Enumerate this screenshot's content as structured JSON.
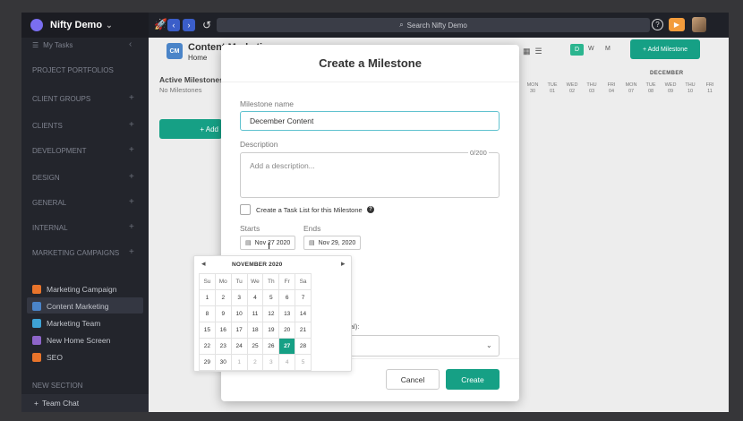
{
  "app": {
    "workspace_name": "Nifty Demo",
    "search_placeholder": "Search Nifty Demo"
  },
  "sidebar": {
    "my_tasks": "My Tasks",
    "portfolio_header": "PROJECT PORTFOLIOS",
    "sections": [
      "CLIENT GROUPS",
      "CLIENTS",
      "DEVELOPMENT",
      "DESIGN",
      "GENERAL",
      "INTERNAL"
    ],
    "marketing_header": "MARKETING CAMPAIGNS",
    "projects": [
      {
        "label": "Marketing Campaign",
        "color": "#e8742b"
      },
      {
        "label": "Content Marketing",
        "color": "#4a84c8"
      },
      {
        "label": "Marketing Team",
        "color": "#3ea2d4"
      },
      {
        "label": "New Home Screen",
        "color": "#8e65c9"
      },
      {
        "label": "SEO",
        "color": "#e8742b"
      }
    ],
    "new_section": "NEW SECTION",
    "team_chat": "Team Chat"
  },
  "project": {
    "logo_initials": "CM",
    "title": "Content Marketing",
    "home_tab": "Home",
    "active_milestones": "Active Milestones",
    "no_milestones": "No Milestones",
    "add_left": "+ Add",
    "add_milestone": "+ Add Milestone",
    "views": [
      "D",
      "W",
      "M"
    ],
    "timeline_month": "DECEMBER",
    "timeline_days": [
      {
        "dow": "MON",
        "date": "30"
      },
      {
        "dow": "TUE",
        "date": "01"
      },
      {
        "dow": "WED",
        "date": "02"
      },
      {
        "dow": "THU",
        "date": "03"
      },
      {
        "dow": "FRI",
        "date": "04"
      },
      {
        "dow": "MON",
        "date": "07"
      },
      {
        "dow": "TUE",
        "date": "08"
      },
      {
        "dow": "WED",
        "date": "09"
      },
      {
        "dow": "THU",
        "date": "10"
      },
      {
        "dow": "FRI",
        "date": "11"
      }
    ]
  },
  "modal": {
    "title": "Create a Milestone",
    "name_label": "Milestone name",
    "name_value": "December Content",
    "description_label": "Description",
    "description_placeholder": "Add a description...",
    "description_count": "0/200",
    "tasklist_label": "Create a Task List for this Milestone",
    "starts_label": "Starts",
    "ends_label": "Ends",
    "starts_value": "Nov 27 2020",
    "ends_value": "Nov 29, 2020",
    "assign_label_partial": "al):",
    "cancel": "Cancel",
    "create": "Create"
  },
  "calendar": {
    "month": "NOVEMBER 2020",
    "weekdays": [
      "Su",
      "Mo",
      "Tu",
      "We",
      "Th",
      "Fr",
      "Sa"
    ],
    "weeks": [
      [
        "1",
        "2",
        "3",
        "4",
        "5",
        "6",
        "7"
      ],
      [
        "8",
        "9",
        "10",
        "11",
        "12",
        "13",
        "14"
      ],
      [
        "15",
        "16",
        "17",
        "18",
        "19",
        "20",
        "21"
      ],
      [
        "22",
        "23",
        "24",
        "25",
        "26",
        "27",
        "28"
      ],
      [
        "29",
        "30",
        "1",
        "2",
        "3",
        "4",
        "5"
      ]
    ],
    "selected": "27"
  },
  "colors": {
    "accent": "#16a085",
    "focus_border": "#61c2cf",
    "sidebar_bg": "#23252c"
  }
}
